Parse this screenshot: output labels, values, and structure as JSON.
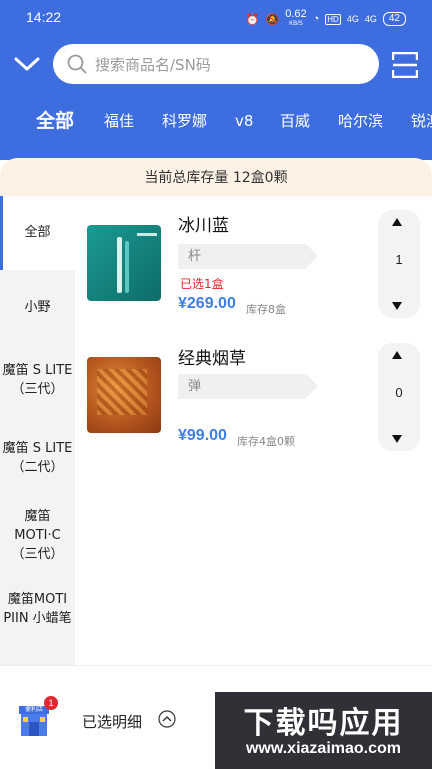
{
  "status_bar": {
    "time": "14:22",
    "net_speed": "0.62",
    "net_unit": "KB/S",
    "hd": "HD",
    "sig1": "4G",
    "sig2": "4G",
    "battery": "42"
  },
  "search": {
    "placeholder": "搜索商品名/SN码"
  },
  "brands": [
    "全部",
    "福佳",
    "科罗娜",
    "v8",
    "百威",
    "哈尔滨",
    "锐澳"
  ],
  "inventory_banner": "当前总库存量 12盒0颗",
  "categories": [
    "全部",
    "小野",
    "魔笛 S LITE\n（三代）",
    "魔笛 S LITE\n（二代）",
    "魔笛\nMOTI·C\n（三代）",
    "魔笛MOTI\nPIIN 小蜡笔"
  ],
  "products": [
    {
      "name": "冰川蓝",
      "spec": "杆",
      "selected": "已选1盒",
      "price": "¥269.00",
      "stock": "库存8盒",
      "qty": "1"
    },
    {
      "name": "经典烟草",
      "spec": "弹",
      "selected": "",
      "price": "¥99.00",
      "stock": "库存4盒0颗",
      "qty": "0"
    }
  ],
  "footer": {
    "detail_label": "已选明细",
    "badge": "1",
    "shop_sign": "便利店"
  },
  "watermark": {
    "title": "下载吗应用",
    "url": "www.xiazaimao.com"
  },
  "colors": {
    "accent": "#3e6de0",
    "price": "#3e7ee6",
    "alert": "#e0292e",
    "banner": "#fdf1e6"
  },
  "icons": [
    "chevron-down-icon",
    "search-icon",
    "scan-icon",
    "chevron-up-icon",
    "store-icon"
  ]
}
